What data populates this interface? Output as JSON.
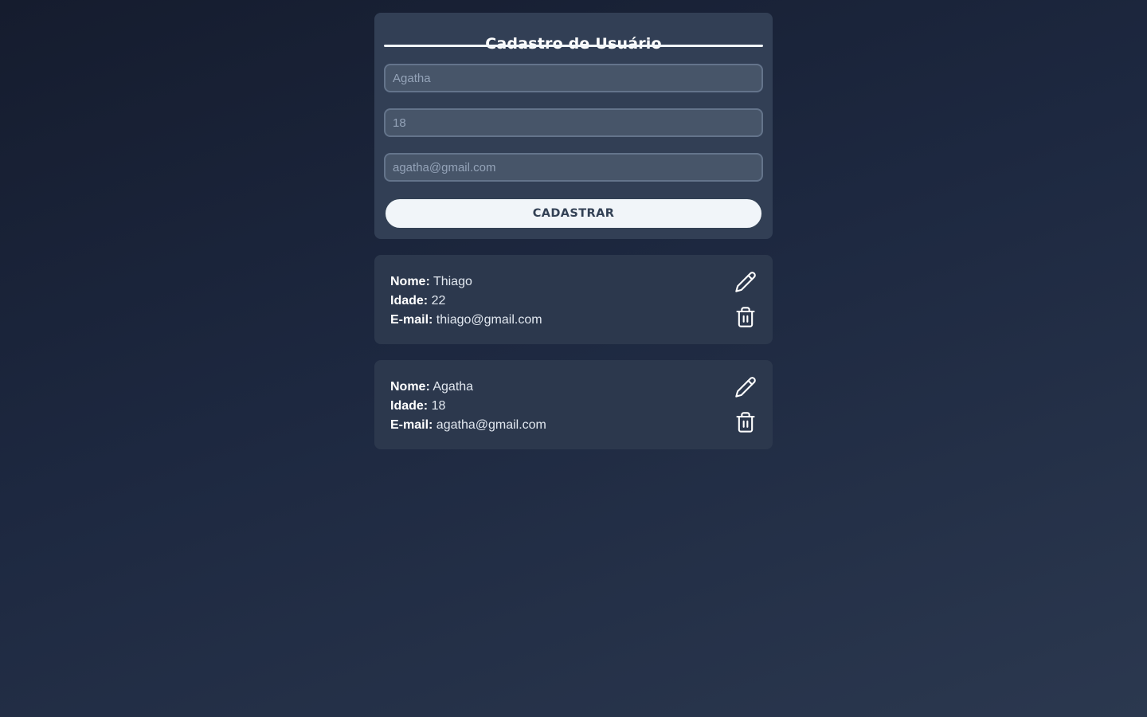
{
  "form": {
    "title": "Cadastro de Usuário",
    "name_placeholder": "Agatha",
    "age_placeholder": "18",
    "email_placeholder": "agatha@gmail.com",
    "submit_label": "CADASTRAR"
  },
  "labels": {
    "name": "Nome:",
    "age": "Idade:",
    "email": "E-mail:"
  },
  "users": [
    {
      "name": "Thiago",
      "age": "22",
      "email": "thiago@gmail.com"
    },
    {
      "name": "Agatha",
      "age": "18",
      "email": "agatha@gmail.com"
    }
  ],
  "icons": {
    "edit": "pencil-icon",
    "delete": "trash-icon"
  },
  "colors": {
    "accent": "#f1f5f9",
    "card_background": "#2c384d",
    "input_background": "#475569"
  }
}
